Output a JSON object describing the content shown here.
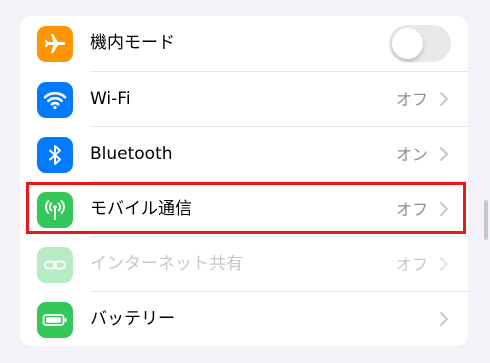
{
  "settings": {
    "rows": [
      {
        "label": "機内モード",
        "icon": "airplane-icon",
        "icon_color": "#ff9500",
        "control": "toggle",
        "toggle_on": false
      },
      {
        "label": "Wi-Fi",
        "icon": "wifi-icon",
        "icon_color": "#007aff",
        "value": "オフ"
      },
      {
        "label": "Bluetooth",
        "icon": "bluetooth-icon",
        "icon_color": "#007aff",
        "value": "オン"
      },
      {
        "label": "モバイル通信",
        "icon": "antenna-icon",
        "icon_color": "#34c759",
        "value": "オフ",
        "highlighted": true
      },
      {
        "label": "インターネット共有",
        "icon": "link-icon",
        "icon_color": "#34c759",
        "value": "オフ",
        "disabled": true
      },
      {
        "label": "バッテリー",
        "icon": "battery-icon",
        "icon_color": "#34c759"
      }
    ]
  },
  "colors": {
    "background": "#f2f2f7",
    "highlight_border": "#e41b1b",
    "secondary_text": "#8e8e93"
  }
}
